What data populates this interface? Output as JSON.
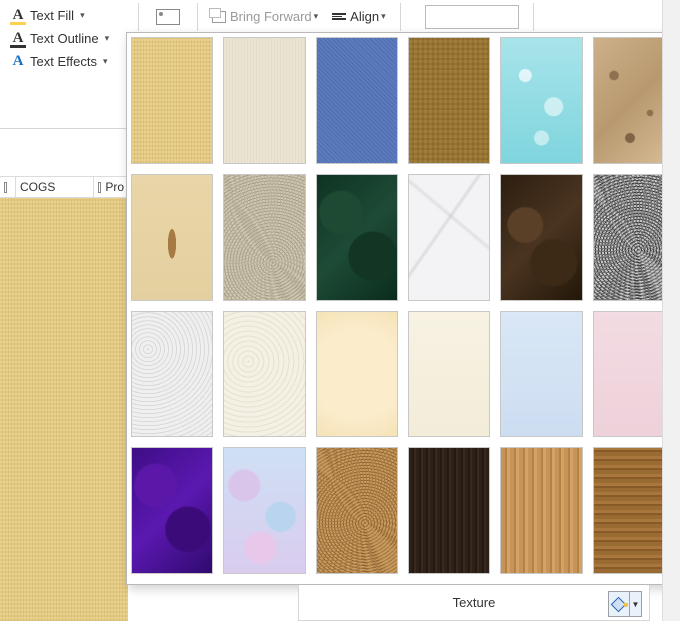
{
  "ribbon": {
    "text_fill": "Text Fill",
    "text_outline": "Text Outline",
    "text_effects": "Text Effects",
    "bring_forward": "Bring Forward",
    "align": "Align"
  },
  "columns": {
    "cogs": "COGS",
    "pro": "Pro"
  },
  "footer": {
    "texture_label": "Texture"
  },
  "textures": [
    {
      "name": "papyrus",
      "cls": "t-papyrus"
    },
    {
      "name": "canvas",
      "cls": "t-canvas"
    },
    {
      "name": "denim",
      "cls": "t-denim"
    },
    {
      "name": "woven-mat",
      "cls": "t-wovenmat"
    },
    {
      "name": "water-droplets",
      "cls": "t-water"
    },
    {
      "name": "paper-bag",
      "cls": "t-paperbag"
    },
    {
      "name": "fish-fossil",
      "cls": "t-fishfossil"
    },
    {
      "name": "sand",
      "cls": "t-sand"
    },
    {
      "name": "green-marble",
      "cls": "t-greenmarble"
    },
    {
      "name": "white-marble",
      "cls": "t-whitemarble"
    },
    {
      "name": "brown-marble",
      "cls": "t-brownmarble"
    },
    {
      "name": "granite",
      "cls": "t-granite"
    },
    {
      "name": "newsprint",
      "cls": "t-newsprint"
    },
    {
      "name": "recycled-paper",
      "cls": "t-recycled"
    },
    {
      "name": "parchment",
      "cls": "t-parchment"
    },
    {
      "name": "stationery",
      "cls": "t-stationery"
    },
    {
      "name": "blue-tissue",
      "cls": "t-bluetissue"
    },
    {
      "name": "pink-tissue",
      "cls": "t-pinktissue"
    },
    {
      "name": "purple-mesh",
      "cls": "t-purplemesh"
    },
    {
      "name": "bouquet",
      "cls": "t-bouquet"
    },
    {
      "name": "cork",
      "cls": "t-cork"
    },
    {
      "name": "walnut",
      "cls": "t-walnut"
    },
    {
      "name": "oak",
      "cls": "t-oak"
    },
    {
      "name": "medium-wood",
      "cls": "t-mediumwood"
    }
  ]
}
